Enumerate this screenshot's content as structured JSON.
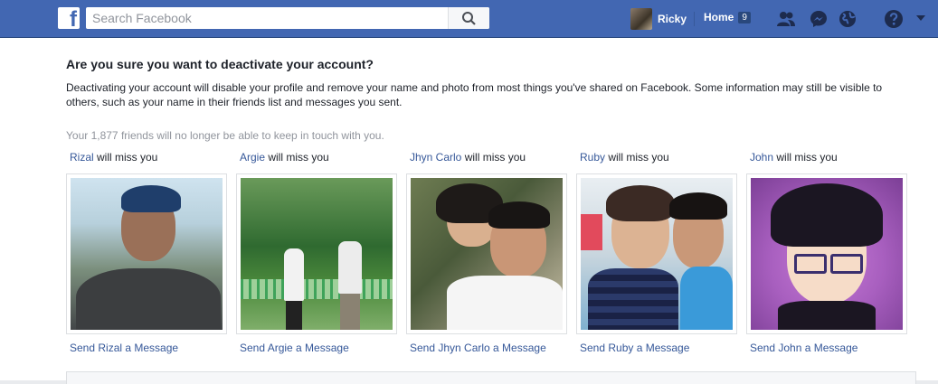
{
  "topbar": {
    "logo_letter": "f",
    "search_placeholder": "Search Facebook",
    "user_name": "Ricky",
    "home_label": "Home",
    "home_count": "9"
  },
  "dialog": {
    "title": "Are you sure you want to deactivate your account?",
    "description": "Deactivating your account will disable your profile and remove your name and photo from most things you've shared on Facebook. Some information may still be visible to others, such as your name in their friends list and messages you sent.",
    "friends_note": "Your 1,877 friends will no longer be able to keep in touch with you.",
    "miss_suffix": " will miss you",
    "friends": [
      {
        "name": "Rizal",
        "message_link": "Send Rizal a Message"
      },
      {
        "name": "Argie",
        "message_link": "Send Argie a Message"
      },
      {
        "name": "Jhyn Carlo",
        "message_link": "Send Jhyn Carlo a Message"
      },
      {
        "name": "Ruby",
        "message_link": "Send Ruby a Message"
      },
      {
        "name": "John",
        "message_link": "Send John a Message"
      }
    ]
  },
  "colors": {
    "brand": "#4267b2",
    "link": "#365899",
    "muted": "#90949c"
  }
}
